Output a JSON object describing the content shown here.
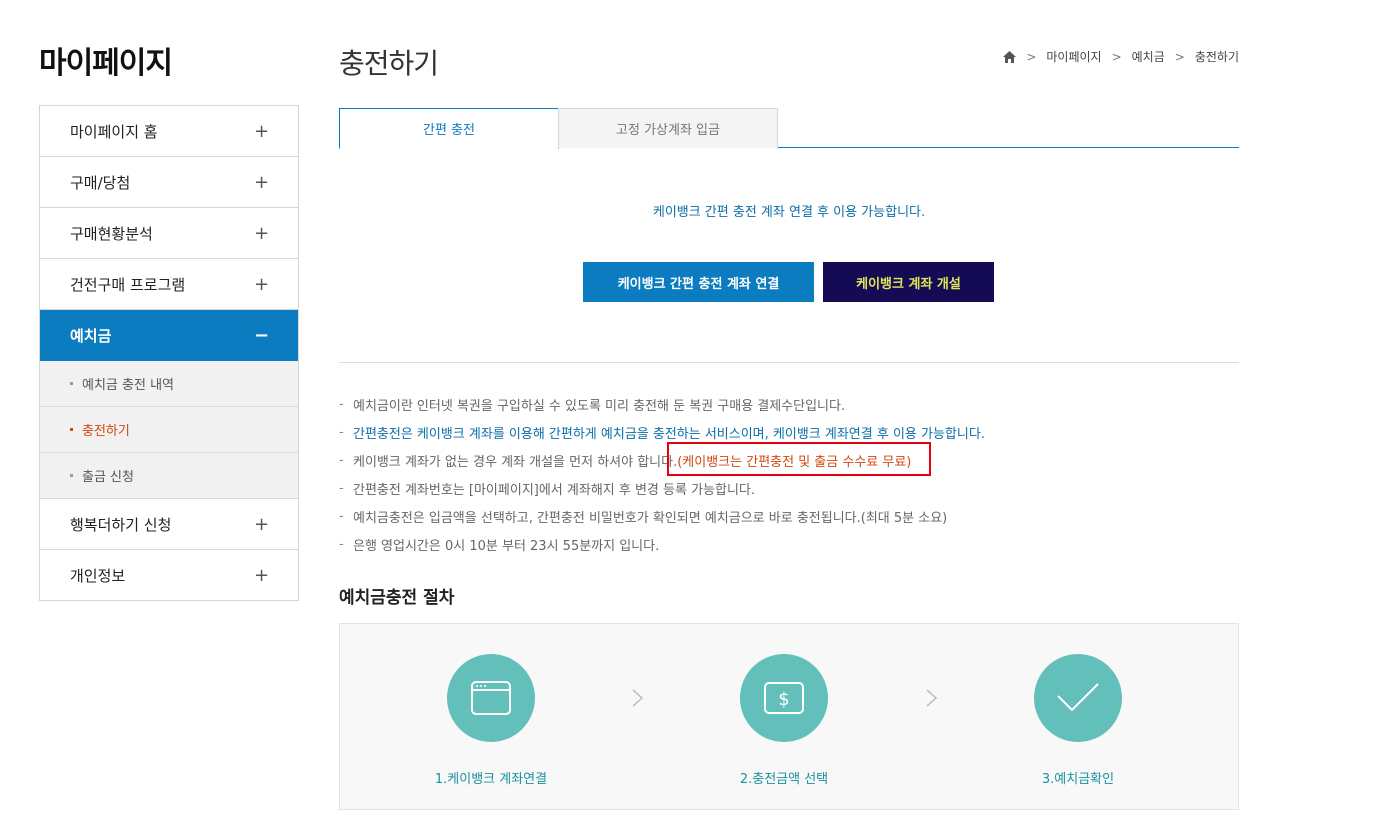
{
  "sidebar": {
    "title": "마이페이지",
    "items": [
      {
        "label": "마이페이지 홈",
        "sign": "+"
      },
      {
        "label": "구매/당첨",
        "sign": "+"
      },
      {
        "label": "구매현황분석",
        "sign": "+"
      },
      {
        "label": "건전구매 프로그램",
        "sign": "+"
      },
      {
        "label": "예치금",
        "sign": "−"
      },
      {
        "label": "행복더하기 신청",
        "sign": "+"
      },
      {
        "label": "개인정보",
        "sign": "+"
      }
    ],
    "subitems": [
      {
        "label": "예치금 충전 내역"
      },
      {
        "label": "충전하기"
      },
      {
        "label": "출금 신청"
      }
    ]
  },
  "header": {
    "title": "충전하기",
    "breadcrumb": [
      "마이페이지",
      "예치금",
      "충전하기"
    ]
  },
  "tabs": [
    {
      "label": "간편 충전"
    },
    {
      "label": "고정 가상계좌 입금"
    }
  ],
  "main": {
    "notice": "케이뱅크 간편 충전 계좌 연결 후 이용 가능합니다.",
    "connect_button": "케이뱅크 간편 충전 계좌 연결",
    "open_button": "케이뱅크 계좌 개설",
    "info": [
      "예치금이란 인터넷 복권을 구입하실 수 있도록 미리 충전해 둔 복권 구매용 결제수단입니다.",
      "간편충전은 케이뱅크 계좌를 이용해 간편하게 예치금을 충전하는 서비스이며, 케이뱅크 계좌연결 후 이용 가능합니다.",
      "케이뱅크 계좌가 없는 경우 계좌 개설을 먼저 하셔야 합니다.",
      "간편충전 계좌번호는 [마이페이지]에서 계좌해지 후 변경 등록 가능합니다.",
      "예치금충전은 입금액을 선택하고, 간편충전 비밀번호가 확인되면 예치금으로 바로 충전됩니다.(최대 5분 소요)",
      "은행 영업시간은 0시 10분 부터 23시 55분까지 입니다."
    ],
    "info_red": " (케이뱅크는 간편충전 및 출금 수수료 무료)",
    "process_title": "예치금충전 절차",
    "steps": [
      {
        "label": "1.케이뱅크 계좌연결",
        "icon": "browser-window-icon"
      },
      {
        "label": "2.충전금액 선택",
        "icon": "dollar-bill-icon"
      },
      {
        "label": "3.예치금확인",
        "icon": "checkmark-icon"
      }
    ]
  },
  "colors": {
    "primary": "#0c7cc0",
    "dark_button": "#150b54",
    "dark_button_text": "#e1e55b",
    "accent_red": "#d2480f",
    "step_circle": "#62bfba",
    "highlight_box": "#e60012"
  }
}
